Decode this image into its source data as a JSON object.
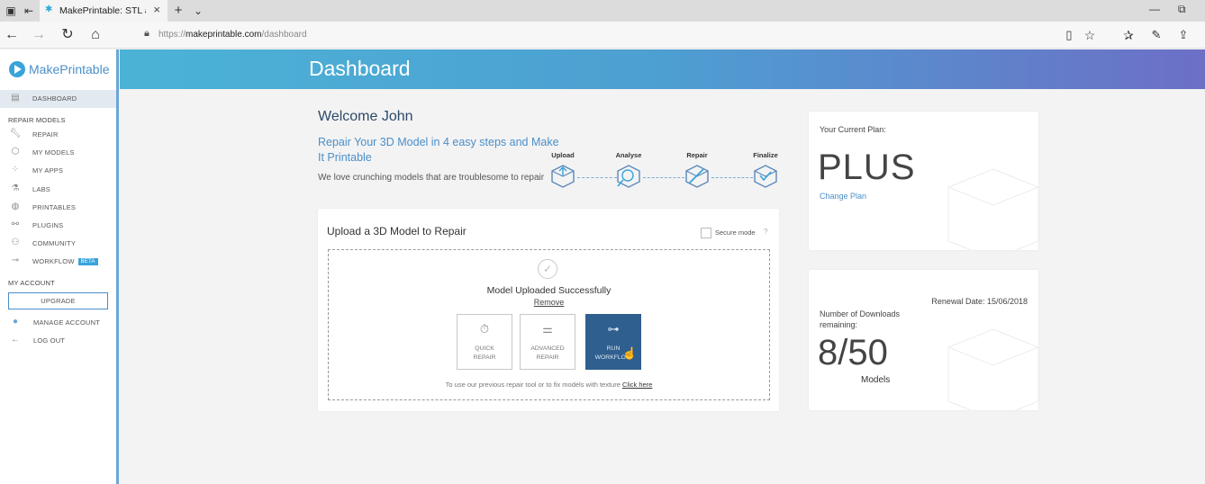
{
  "browser": {
    "tab_title": "MakePrintable: STL and",
    "url_prefix": "https://",
    "url_domain": "makeprintable.com",
    "url_path": "/dashboard"
  },
  "sidebar": {
    "logo_text": "MakePrintable",
    "active_item": "DASHBOARD",
    "section_repair": "REPAIR MODELS",
    "items": [
      {
        "label": "REPAIR",
        "icon": "wrench-icon"
      },
      {
        "label": "MY MODELS",
        "icon": "cube-icon"
      },
      {
        "label": "MY APPS",
        "icon": "apps-grid-icon"
      },
      {
        "label": "LABS",
        "icon": "flask-icon"
      },
      {
        "label": "PRINTABLES",
        "icon": "globe-icon"
      },
      {
        "label": "PLUGINS",
        "icon": "plug-icon"
      },
      {
        "label": "COMMUNITY",
        "icon": "people-icon"
      },
      {
        "label": "WORKFLOW",
        "icon": "workflow-arrow-icon",
        "badge": "BETA"
      }
    ],
    "section_account": "MY ACCOUNT",
    "upgrade_label": "UPGRADE",
    "manage_account": "MANAGE ACCOUNT",
    "log_out": "LOG OUT"
  },
  "header": {
    "title": "Dashboard"
  },
  "welcome": {
    "greeting": "Welcome John",
    "tagline": "Repair Your 3D Model in 4 easy steps and Make It Printable",
    "subtag": "We love crunching models that are troublesome to repair"
  },
  "steps": [
    "Upload",
    "Analyse",
    "Repair",
    "Finalize"
  ],
  "upload": {
    "title": "Upload a 3D Model to Repair",
    "secure_mode": "Secure mode",
    "success": "Model Uploaded Successfully",
    "remove": "Remove",
    "options": [
      {
        "line1": "QUICK",
        "line2": "REPAIR"
      },
      {
        "line1": "ADVANCED",
        "line2": "REPAIR"
      },
      {
        "line1": "RUN",
        "line2": "WORKFLOW"
      }
    ],
    "foot_text": "To use our previous repair tool or to fix models with texture",
    "foot_link": "Click here"
  },
  "plan": {
    "label": "Your Current Plan:",
    "name": "PLUS",
    "change": "Change Plan"
  },
  "downloads": {
    "renewal": "Renewal Date: 15/06/2018",
    "label": "Number of Downloads remaining:",
    "count": "8/50",
    "unit": "Models"
  },
  "colors": {
    "accent": "#4a8fc8",
    "header_start": "#4bb3d6",
    "header_end": "#6c6fc6",
    "active_button": "#2f5f8f"
  }
}
